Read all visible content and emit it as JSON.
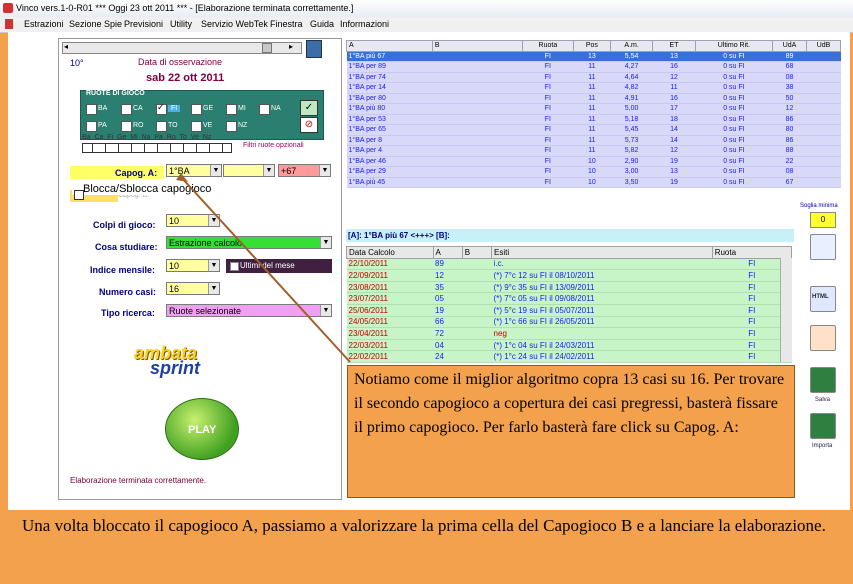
{
  "window": {
    "title": "Vinco vers.1-0-R01  ***  Oggi 23 ott 2011  ***  - [Elaborazione terminata correttamente.]"
  },
  "menu": [
    "Estrazioni",
    "Sezione Spie",
    "Previsioni",
    "Utility",
    "Servizio WebTek",
    "Finestra",
    "Guida",
    "Informazioni"
  ],
  "left": {
    "scroll_val": "10°",
    "data_label": "Data di osservazione",
    "date": "sab 22 ott 2011",
    "ruote_title": "RUOTE DI GIOCO",
    "ruote": [
      "BA",
      "CA",
      "FI",
      "GE",
      "MI",
      "NA",
      "PA",
      "RO",
      "TO",
      "VE",
      "NZ"
    ],
    "ruote_short": "Ba  Ca  Fi  Ge  Mi  Na  Pa  Ro  To  Ve  Nz",
    "filtri": "Filtri ruote opzionali",
    "capog_a_label": "Capog. A:",
    "capog_a_value": "1°BA",
    "capog_a_extra": "+67",
    "capog_b_label": "Capog. B:",
    "blocca": "Blocca/Sblocca capogioco",
    "colpi_label": "Colpi di gioco:",
    "colpi_value": "10",
    "cosa_label": "Cosa studiare:",
    "cosa_value": "Estrazione calcolo",
    "indice_label": "Indice mensile:",
    "indice_value": "10",
    "ultimi_label": "Ultimi del mese",
    "numcasi_label": "Numero casi:",
    "numcasi_value": "16",
    "tipo_label": "Tipo ricerca:",
    "tipo_value": "Ruote selezionate",
    "logo1": "ambata",
    "logo2": "sprint",
    "play": "PLAY",
    "status": "Elaborazione terminata correttamente."
  },
  "top_table": {
    "headers": [
      "A",
      "B",
      "Ruota",
      "Pos",
      "A.m.",
      "ET",
      "Ultimo Rit.",
      "UdA",
      "UdB"
    ],
    "rows": [
      [
        "1°BA  più 67",
        "",
        "FI",
        "13",
        "5,54",
        "13",
        "0 su FI",
        "89",
        ""
      ],
      [
        "1°BA  per 89",
        "",
        "FI",
        "11",
        "4,27",
        "16",
        "0 su FI",
        "68",
        ""
      ],
      [
        "1°BA  per 74",
        "",
        "FI",
        "11",
        "4,64",
        "12",
        "0 su FI",
        "08",
        ""
      ],
      [
        "1°BA  per 14",
        "",
        "FI",
        "11",
        "4,82",
        "11",
        "0 su FI",
        "38",
        ""
      ],
      [
        "1°BA  per 80",
        "",
        "FI",
        "11",
        "4,91",
        "16",
        "0 su FI",
        "50",
        ""
      ],
      [
        "1°BA  più 80",
        "",
        "FI",
        "11",
        "5,00",
        "17",
        "0 su FI",
        "12",
        ""
      ],
      [
        "1°BA  per 53",
        "",
        "FI",
        "11",
        "5,18",
        "18",
        "0 su FI",
        "86",
        ""
      ],
      [
        "1°BA  per 65",
        "",
        "FI",
        "11",
        "5,45",
        "14",
        "0 su FI",
        "80",
        ""
      ],
      [
        "1°BA  per 8",
        "",
        "FI",
        "11",
        "5,73",
        "14",
        "0 su FI",
        "86",
        ""
      ],
      [
        "1°BA  per 4",
        "",
        "FI",
        "11",
        "5,82",
        "12",
        "0 su FI",
        "88",
        ""
      ],
      [
        "1°BA  per 46",
        "",
        "FI",
        "10",
        "2,90",
        "19",
        "0 su FI",
        "22",
        ""
      ],
      [
        "1°BA  per 29",
        "",
        "FI",
        "10",
        "3,00",
        "13",
        "0 su FI",
        "08",
        ""
      ],
      [
        "1°BA  più 45",
        "",
        "FI",
        "10",
        "3,50",
        "19",
        "0 su FI",
        "67",
        ""
      ]
    ]
  },
  "soglia_label": "Soglia minima",
  "soglia_value": "0",
  "result_title": "[A]: 1°BA  più 67 <+++> [B]:",
  "bottom_table": {
    "headers": [
      "Data Calcolo",
      "A",
      "B",
      "Esiti",
      "Ruota"
    ],
    "rows": [
      [
        "22/10/2011",
        "89",
        "",
        "i.c.",
        "FI"
      ],
      [
        "22/09/2011",
        "12",
        "",
        "(*) 7°c 12 su FI il 08/10/2011",
        "FI"
      ],
      [
        "23/08/2011",
        "35",
        "",
        "(*) 9°c 35 su FI il 13/09/2011",
        "FI"
      ],
      [
        "23/07/2011",
        "05",
        "",
        "(*) 7°c 05 su FI il 09/08/2011",
        "FI"
      ],
      [
        "25/06/2011",
        "19",
        "",
        "(*) 5°c 19 su FI il 05/07/2011",
        "FI"
      ],
      [
        "24/05/2011",
        "66",
        "",
        "(*) 1°c 66 su FI il 26/05/2011",
        "FI"
      ],
      [
        "23/04/2011",
        "72",
        "",
        "neg",
        "FI"
      ],
      [
        "22/03/2011",
        "04",
        "",
        "(*) 1°c 04 su FI il 24/03/2011",
        "FI"
      ],
      [
        "22/02/2011",
        "24",
        "",
        "(*) 1°c 24 su FI il 24/02/2011",
        "FI"
      ]
    ]
  },
  "side": {
    "salva": "Salva",
    "importa": "Importa",
    "html": "HTML"
  },
  "annotation": "Notiamo come il miglior algoritmo copra 13 casi su 16. Per trovare il secondo capogioco a copertura dei casi pregressi, basterà fissare il primo capogioco. Per farlo basterà fare click su Capog. A:",
  "bottom_text": "Una volta bloccato il capogioco A, passiamo a valorizzare la prima cella del Capogioco B e a lanciare la elaborazione.",
  "colors": {
    "frame": "#f4a14d",
    "ruote_bg": "#2a7f70",
    "row_blue": "#d8d8f8",
    "row_green": "#c8f5c8",
    "arrow": "#a0602a"
  }
}
